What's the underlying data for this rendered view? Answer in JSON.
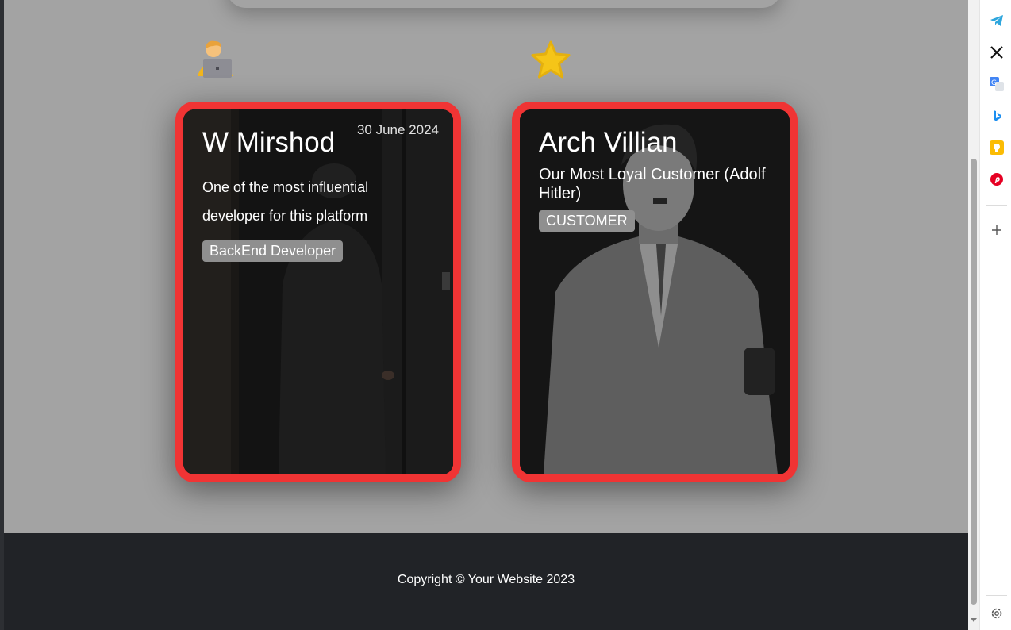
{
  "decorations": {
    "developer_emoji": "technologist-emoji",
    "star_emoji": "star-emoji"
  },
  "cards": [
    {
      "date": "30 June 2024",
      "name": "W Mirshod",
      "description": "One of the most influential developer for this platform",
      "badge": "BackEnd Developer"
    },
    {
      "name": "Arch Villian",
      "description": "Our Most Loyal Customer (Adolf Hitler)",
      "badge": "CUSTOMER"
    }
  ],
  "footer": {
    "copyright": "Copyright © Your Website 2023"
  },
  "sidebar": {
    "items": [
      "telegram-icon",
      "x-icon",
      "translate-icon",
      "bing-icon",
      "keep-icon",
      "pinterest-icon",
      "add-icon",
      "settings-icon"
    ]
  },
  "colors": {
    "card_border": "#f03434",
    "page_background": "#a3a3a3",
    "footer_background": "#212327",
    "badge_background": "#8f8f8f"
  }
}
